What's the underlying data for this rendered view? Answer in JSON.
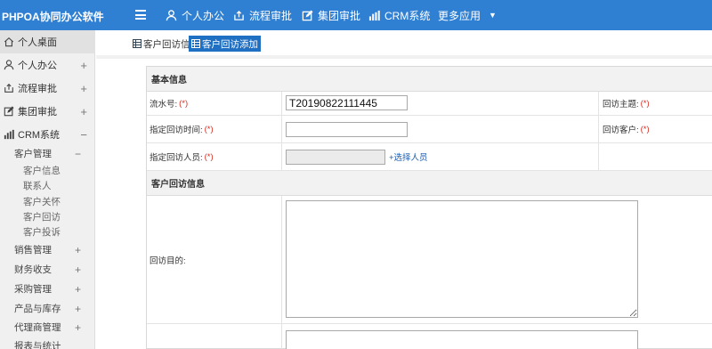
{
  "app": {
    "title": "PHPOA协同办公软件"
  },
  "topnav": {
    "items": [
      {
        "label": "个人办公",
        "icon": "user-icon"
      },
      {
        "label": "流程审批",
        "icon": "workflow-icon"
      },
      {
        "label": "集团审批",
        "icon": "edit-icon"
      },
      {
        "label": "CRM系统",
        "icon": "bar-chart-icon"
      }
    ],
    "more": "更多应用",
    "more_caret": "▼"
  },
  "sidebar": {
    "items": [
      {
        "label": "个人桌面",
        "icon": "home-icon",
        "toggle": ""
      },
      {
        "label": "个人办公",
        "icon": "user-icon",
        "toggle": "+"
      },
      {
        "label": "流程审批",
        "icon": "workflow-icon",
        "toggle": "+"
      },
      {
        "label": "集团审批",
        "icon": "edit-icon",
        "toggle": "+"
      },
      {
        "label": "CRM系统",
        "icon": "bar-chart-icon",
        "toggle": "−"
      }
    ],
    "crm": {
      "customer_mgmt": {
        "label": "客户管理",
        "toggle": "−"
      },
      "leaves": [
        "客户信息",
        "联系人",
        "客户关怀",
        "客户回访",
        "客户投诉"
      ],
      "groups": [
        {
          "label": "销售管理",
          "toggle": "+"
        },
        {
          "label": "财务收支",
          "toggle": "+"
        },
        {
          "label": "采购管理",
          "toggle": "+"
        },
        {
          "label": "产品与库存",
          "toggle": "+"
        },
        {
          "label": "代理商管理",
          "toggle": "+"
        },
        {
          "label": "报表与统计",
          "toggle": ""
        }
      ]
    }
  },
  "tabs": [
    {
      "label": "客户回访信息"
    },
    {
      "label": "客户回访添加"
    }
  ],
  "form": {
    "basic_section": "基本信息",
    "serial": {
      "label": "流水号:",
      "req": "(*)",
      "value": "T20190822111445"
    },
    "theme": {
      "label": "回访主题:",
      "req": "(*)"
    },
    "visit_time": {
      "label": "指定回访时间:",
      "req": "(*)",
      "value": ""
    },
    "customer": {
      "label": "回访客户:",
      "req": "(*)"
    },
    "visitor": {
      "label": "指定回访人员:",
      "req": "(*)",
      "value": "",
      "link": "+选择人员"
    },
    "visit_section": "客户回访信息",
    "purpose": {
      "label": "回访目的:"
    }
  }
}
